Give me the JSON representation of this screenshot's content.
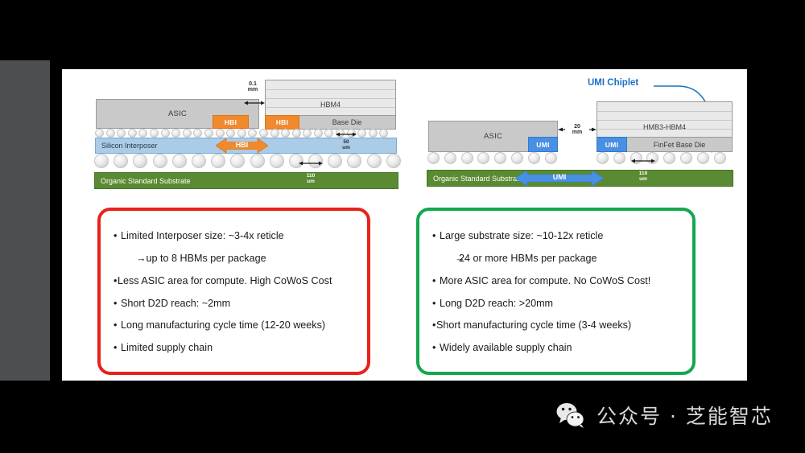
{
  "slide": {
    "left_diagram": {
      "asic_label": "ASIC",
      "hbi_label": "HBI",
      "hbm_label": "HBM4",
      "base_die_label": "Base Die",
      "interposer_label": "Silicon Interposer",
      "substrate_label": "Organic Standard Substrate",
      "gap_dim_value": "0.1",
      "gap_dim_unit": "mm",
      "microbump_pitch_value": "50",
      "microbump_pitch_unit": "um",
      "ballpitch_value": "110",
      "ballpitch_unit": "um",
      "d2d_arrow_label": "HBI"
    },
    "right_diagram": {
      "asic_label": "ASIC",
      "umi_label": "UMI",
      "hbm_label": "HMB3-HBM4",
      "base_die_label": "FinFet Base Die",
      "substrate_label": "Organic Standard Substrate",
      "gap_dim_value": "20",
      "gap_dim_unit": "mm",
      "ballpitch_value": "110",
      "ballpitch_unit": "um",
      "d2d_arrow_label": "UMI",
      "callout_label": "UMI Chiplet"
    },
    "left_box": {
      "border_color": "#e8211b",
      "bullets": [
        {
          "marker": "•",
          "text": "Limited Interposer size: ~3-4x reticle",
          "indent": false,
          "tight": false
        },
        {
          "marker": "→",
          "text": "up to 8 HBMs per package",
          "indent": true,
          "tight": false
        },
        {
          "marker": "•",
          "text": "Less ASIC area for compute. High CoWoS Cost",
          "indent": false,
          "tight": true
        },
        {
          "marker": "•",
          "text": "Short D2D reach: ~2mm",
          "indent": false,
          "tight": false
        },
        {
          "marker": "•",
          "text": "Long manufacturing cycle time (12-20 weeks)",
          "indent": false,
          "tight": false
        },
        {
          "marker": "•",
          "text": "Limited supply chain",
          "indent": false,
          "tight": false
        }
      ]
    },
    "right_box": {
      "border_color": "#12a84e",
      "bullets": [
        {
          "marker": "•",
          "text": "Large substrate size: ~10-12x reticle",
          "indent": false,
          "tight": false
        },
        {
          "marker": "→",
          "text": "24 or more HBMs per package",
          "indent": true,
          "tight": true
        },
        {
          "marker": "•",
          "text": "More ASIC area for compute. No CoWoS Cost!",
          "indent": false,
          "tight": false
        },
        {
          "marker": "•",
          "text": "Long D2D reach: >20mm",
          "indent": false,
          "tight": false
        },
        {
          "marker": "•",
          "text": "Short manufacturing cycle time (3-4 weeks)",
          "indent": false,
          "tight": true
        },
        {
          "marker": "•",
          "text": "Widely available supply chain",
          "indent": false,
          "tight": false
        }
      ]
    }
  },
  "watermark": {
    "icon": "wechat-icon",
    "text": "公众号 · 芝能智芯"
  },
  "colors": {
    "hbi_orange": "#f08a2c",
    "umi_blue": "#4a90e2",
    "interposer_blue": "#aacce8",
    "substrate_green": "#5a8a32",
    "die_gray": "#c9c9c9",
    "callout_blue": "#1b72c4",
    "red_border": "#e8211b",
    "green_border": "#12a84e"
  }
}
